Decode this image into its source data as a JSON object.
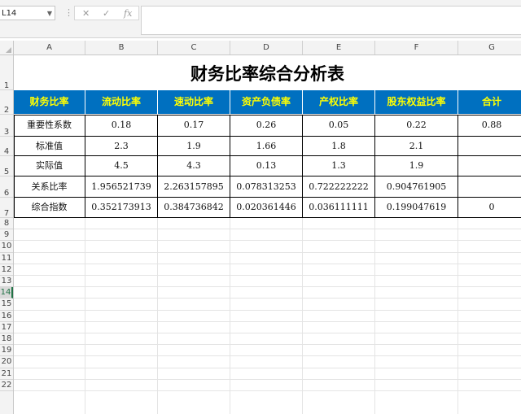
{
  "formula_bar": {
    "name_box": "L14",
    "cancel_icon": "✕",
    "enter_icon": "✓",
    "fx_label": "fx",
    "formula": ""
  },
  "columns": [
    "A",
    "B",
    "C",
    "D",
    "E",
    "F",
    "G"
  ],
  "rows": [
    "1",
    "2",
    "3",
    "4",
    "5",
    "6",
    "7",
    "8",
    "9",
    "10",
    "11",
    "12",
    "13",
    "14",
    "15",
    "16",
    "17",
    "18",
    "19",
    "20",
    "21",
    "22"
  ],
  "selected_row": "14",
  "sheet": {
    "title": "财务比率综合分析表",
    "headers": [
      "财务比率",
      "流动比率",
      "速动比率",
      "资产负债率",
      "产权比率",
      "股东权益比率",
      "合计"
    ],
    "body": [
      [
        "重要性系数",
        "0.18",
        "0.17",
        "0.26",
        "0.05",
        "0.22",
        "0.88"
      ],
      [
        "标准值",
        "2.3",
        "1.9",
        "1.66",
        "1.8",
        "2.1",
        ""
      ],
      [
        "实际值",
        "4.5",
        "4.3",
        "0.13",
        "1.3",
        "1.9",
        ""
      ],
      [
        "关系比率",
        "1.956521739",
        "2.263157895",
        "0.078313253",
        "0.722222222",
        "0.904761905",
        ""
      ],
      [
        "综合指数",
        "0.352173913",
        "0.384736842",
        "0.020361446",
        "0.036111111",
        "0.199047619",
        "0"
      ]
    ]
  },
  "colors": {
    "header_bg": "#0070c0",
    "header_text": "#ffff00",
    "selection": "#217346"
  }
}
